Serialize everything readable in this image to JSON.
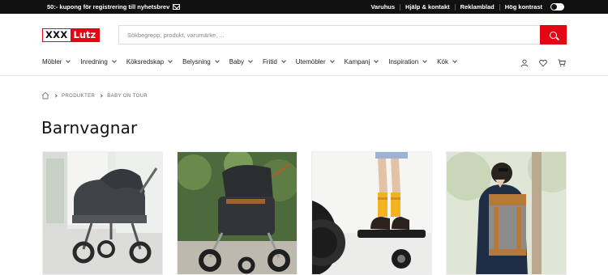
{
  "topbar": {
    "promo": "50:- kupong för registrering till nyhetsbrev",
    "links": [
      "Varuhus",
      "Hjälp & kontakt",
      "Reklamblad",
      "Hög kontrast"
    ]
  },
  "logo": {
    "part1": "XXX",
    "part2": "Lutz"
  },
  "search": {
    "placeholder": "Sökbegrepp, produkt, varumärke, ..."
  },
  "nav": {
    "items": [
      "Möbler",
      "Inredning",
      "Köksredskap",
      "Belysning",
      "Baby",
      "Fritid",
      "Utemöbler",
      "Kampanj",
      "Inspiration",
      "Kök"
    ]
  },
  "breadcrumb": {
    "items": [
      "PRODUKTER",
      "BABY ON TOUR"
    ]
  },
  "page": {
    "title": "Barnvagnar"
  },
  "colors": {
    "accent": "#e30613",
    "topbar": "#111111"
  },
  "icons": [
    "mail-icon",
    "search-icon",
    "chevron-down-icon",
    "user-icon",
    "heart-icon",
    "cart-icon",
    "home-icon"
  ]
}
